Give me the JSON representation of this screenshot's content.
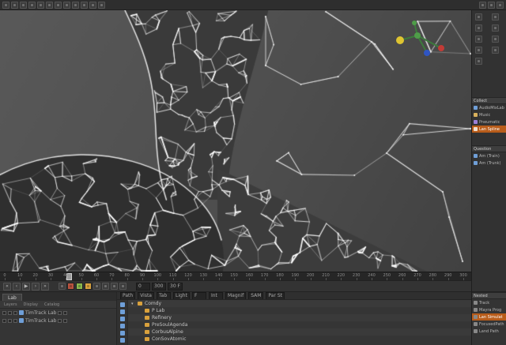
{
  "app": {
    "accent": "#b85c1a"
  },
  "top_toolbar": {
    "left_icons": [
      "app-menu",
      "select-tool",
      "move-tool",
      "rotate-tool",
      "scale-tool",
      "snap-magnet",
      "axis-lock",
      "camera",
      "shading-mode",
      "viewport-layout",
      "filter",
      "options"
    ],
    "right_icons": [
      "record",
      "screen-layout",
      "help"
    ]
  },
  "gizmo": {
    "x_color": "#c23b36",
    "y_color": "#4f9d49",
    "z_color": "#2f55c2",
    "pivot_color": "#dec431",
    "line_color": "#3c7a3c"
  },
  "timeline": {
    "start": 0,
    "end": 300,
    "label_step": 10,
    "current_frame": 42
  },
  "transport": {
    "icons": [
      {
        "name": "go-to-start",
        "glyph": "«"
      },
      {
        "name": "step-back",
        "glyph": "‹"
      },
      {
        "name": "play",
        "glyph": "▶"
      },
      {
        "name": "step-forward",
        "glyph": "›"
      },
      {
        "name": "go-to-end",
        "glyph": "»"
      }
    ],
    "mode_icons": [
      {
        "name": "loop",
        "color": ""
      },
      {
        "name": "record-keyframe",
        "color": "#b9533f"
      },
      {
        "name": "auto-key",
        "color": "#89b84d"
      },
      {
        "name": "snap-key",
        "color": "#d9a13d"
      },
      {
        "name": "filter-keys",
        "color": ""
      },
      {
        "name": "motion-path",
        "color": ""
      },
      {
        "name": "ghosting",
        "color": ""
      },
      {
        "name": "markers",
        "color": ""
      }
    ],
    "fields": {
      "range_start": "0",
      "range_end": "300",
      "fps": "30 F"
    }
  },
  "sidebar": {
    "tool_icons": [
      "layers",
      "wireframe",
      "snap",
      "grid",
      "camera",
      "lights",
      "materials",
      "history",
      "settings"
    ],
    "sections": [
      {
        "header": "Collect",
        "rows": [
          {
            "label": "AudioMixLab",
            "color": "#6f9fd8",
            "selected": false
          },
          {
            "label": "Music",
            "color": "#d8b05c",
            "selected": false
          },
          {
            "label": "Pneumatic",
            "color": "#9a7fd8",
            "selected": false
          },
          {
            "label": "Lan Spline",
            "color": "#f0e0d0",
            "selected": true
          }
        ]
      },
      {
        "header": "Question",
        "rows": [
          {
            "label": "Am (Train)",
            "color": "#6f9fd8",
            "selected": false
          },
          {
            "label": "Am (Trunk)",
            "color": "#6f9fd8",
            "selected": false
          }
        ]
      }
    ],
    "bottom": {
      "header": "Nested",
      "rows": [
        {
          "label": "Track",
          "selected": false
        },
        {
          "label": "Mayra Prog",
          "selected": false
        },
        {
          "label": "Lan Simulat",
          "selected": true
        },
        {
          "label": "FocusedPath",
          "selected": false
        },
        {
          "label": "Land Path",
          "selected": false
        }
      ]
    }
  },
  "layers_panel": {
    "tab": "Lab",
    "columns": [
      "Layers",
      "Display",
      "Catalog"
    ],
    "rows": [
      {
        "label": "TimTrack Lab"
      },
      {
        "label": "TimTrack Lab"
      }
    ]
  },
  "tree_panel": {
    "fields": [
      "Path",
      "Vista",
      "Tab",
      "Light",
      "F",
      "Int",
      "Magnif",
      "SAM",
      "Par St"
    ],
    "items": [
      {
        "label": "Comdy",
        "depth": 0,
        "expanded": true
      },
      {
        "label": "P Lab",
        "depth": 1
      },
      {
        "label": "Refinery",
        "depth": 1
      },
      {
        "label": "PreSoulAgenda",
        "depth": 1
      },
      {
        "label": "CorbusAlpine",
        "depth": 1
      },
      {
        "label": "ConSovAtomic",
        "depth": 1
      }
    ]
  }
}
